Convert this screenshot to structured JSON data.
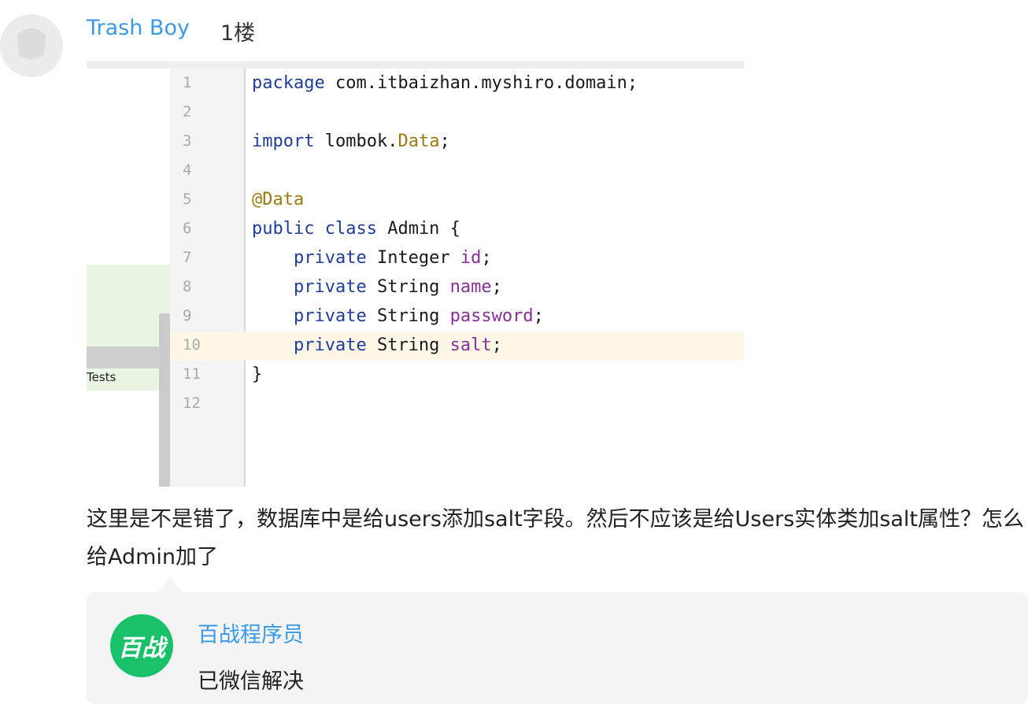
{
  "comment": {
    "username": "Trash Boy",
    "floor": "1楼",
    "text": "这里是不是错了，数据库中是给users添加salt字段。然后不应该是给Users实体类加salt属性？怎么给Admin加了"
  },
  "screenshot": {
    "side_label": "Tests",
    "lines": [
      {
        "num": "1",
        "segments": [
          {
            "t": "package",
            "c": "kw"
          },
          {
            "t": " com.itbaizhan.myshiro.domain;",
            "c": ""
          }
        ]
      },
      {
        "num": "2",
        "segments": []
      },
      {
        "num": "3",
        "segments": [
          {
            "t": "import",
            "c": "kw"
          },
          {
            "t": " lombok.",
            "c": ""
          },
          {
            "t": "Data",
            "c": "ann"
          },
          {
            "t": ";",
            "c": ""
          }
        ]
      },
      {
        "num": "4",
        "segments": []
      },
      {
        "num": "5",
        "segments": [
          {
            "t": "@Data",
            "c": "ann"
          }
        ]
      },
      {
        "num": "6",
        "segments": [
          {
            "t": "public class",
            "c": "kw"
          },
          {
            "t": " Admin {",
            "c": ""
          }
        ]
      },
      {
        "num": "7",
        "segments": [
          {
            "t": "    ",
            "c": ""
          },
          {
            "t": "private",
            "c": "kw"
          },
          {
            "t": " Integer ",
            "c": ""
          },
          {
            "t": "id",
            "c": "fld"
          },
          {
            "t": ";",
            "c": ""
          }
        ]
      },
      {
        "num": "8",
        "segments": [
          {
            "t": "    ",
            "c": ""
          },
          {
            "t": "private",
            "c": "kw"
          },
          {
            "t": " String ",
            "c": ""
          },
          {
            "t": "name",
            "c": "fld"
          },
          {
            "t": ";",
            "c": ""
          }
        ]
      },
      {
        "num": "9",
        "segments": [
          {
            "t": "    ",
            "c": ""
          },
          {
            "t": "private",
            "c": "kw"
          },
          {
            "t": " String ",
            "c": ""
          },
          {
            "t": "password",
            "c": "fld"
          },
          {
            "t": ";",
            "c": ""
          }
        ]
      },
      {
        "num": "10",
        "segments": [
          {
            "t": "    ",
            "c": ""
          },
          {
            "t": "private",
            "c": "kw"
          },
          {
            "t": " String ",
            "c": ""
          },
          {
            "t": "salt",
            "c": "fld"
          },
          {
            "t": ";",
            "c": ""
          }
        ]
      },
      {
        "num": "11",
        "segments": [
          {
            "t": "}",
            "c": ""
          }
        ]
      },
      {
        "num": "12",
        "segments": []
      }
    ]
  },
  "reply": {
    "avatar_text": "百战",
    "username": "百战程序员",
    "text": "已微信解决"
  },
  "colors": {
    "link_blue": "#3b9ae8",
    "reply_bg": "#f4f4f4",
    "avatar_green": "#19c26a"
  }
}
